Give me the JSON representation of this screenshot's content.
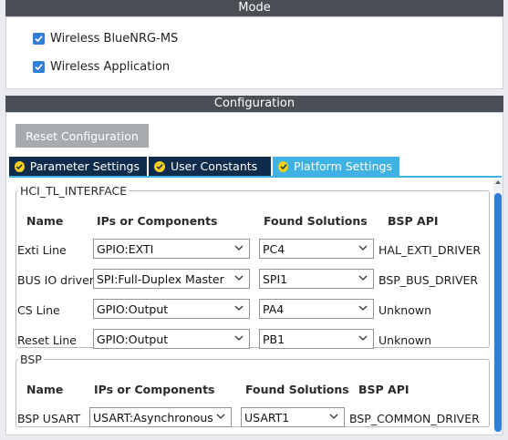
{
  "mode": {
    "title": "Mode",
    "checkboxes": [
      {
        "label": "Wireless BlueNRG-MS",
        "checked": true
      },
      {
        "label": "Wireless Application",
        "checked": true
      }
    ]
  },
  "configuration": {
    "title": "Configuration",
    "reset_label": "Reset Configuration",
    "tabs": [
      {
        "label": "Parameter Settings",
        "icon": "check-circle-icon"
      },
      {
        "label": "User Constants",
        "icon": "check-circle-icon"
      },
      {
        "label": "Platform Settings",
        "icon": "check-circle-icon",
        "active": true
      }
    ]
  },
  "hci": {
    "legend": "HCI_TL_INTERFACE",
    "headers": {
      "name": "Name",
      "ips": "IPs or Components",
      "found": "Found Solutions",
      "api": "BSP API"
    },
    "rows": [
      {
        "name": "Exti Line",
        "ip": "GPIO:EXTI",
        "found": "PC4",
        "api": "HAL_EXTI_DRIVER"
      },
      {
        "name": "BUS IO driver",
        "ip": "SPI:Full-Duplex Master",
        "found": "SPI1",
        "api": "BSP_BUS_DRIVER"
      },
      {
        "name": "CS Line",
        "ip": "GPIO:Output",
        "found": "PA4",
        "api": "Unknown"
      },
      {
        "name": "Reset Line",
        "ip": "GPIO:Output",
        "found": "PB1",
        "api": "Unknown"
      }
    ]
  },
  "bsp": {
    "legend": "BSP",
    "headers": {
      "name": "Name",
      "ips": "IPs or Components",
      "found": "Found Solutions",
      "api": "BSP API"
    },
    "rows": [
      {
        "name": "BSP USART",
        "ip": "USART:Asynchronous",
        "found": "USART1",
        "api": "BSP_COMMON_DRIVER"
      }
    ]
  },
  "colors": {
    "header_bg": "#4a4f55",
    "tab_bg": "#0f2c4d",
    "tab_active_bg": "#3fb2e4",
    "checkbox_blue": "#2f7fd6",
    "tab_icon_yellow": "#f5d020"
  }
}
